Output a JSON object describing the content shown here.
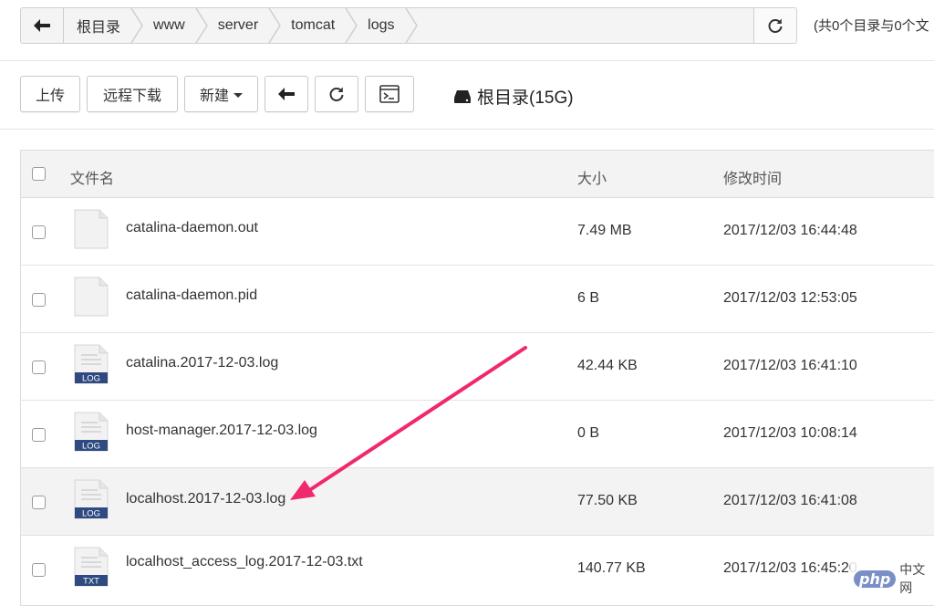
{
  "breadcrumb": {
    "items": [
      "根目录",
      "www",
      "server",
      "tomcat",
      "logs"
    ]
  },
  "summary": "(共0个目录与0个文",
  "toolbar": {
    "upload": "上传",
    "remote_download": "远程下载",
    "new": "新建"
  },
  "disk": {
    "label": "根目录(15G)"
  },
  "table": {
    "headers": {
      "name": "文件名",
      "size": "大小",
      "mtime": "修改时间"
    },
    "rows": [
      {
        "name": "catalina-daemon.out",
        "size": "7.49 MB",
        "mtime": "2017/12/03 16:44:48",
        "icon": "blank-file-icon",
        "badge": ""
      },
      {
        "name": "catalina-daemon.pid",
        "size": "6 B",
        "mtime": "2017/12/03 12:53:05",
        "icon": "blank-file-icon",
        "badge": ""
      },
      {
        "name": "catalina.2017-12-03.log",
        "size": "42.44 KB",
        "mtime": "2017/12/03 16:41:10",
        "icon": "log-file-icon",
        "badge": "LOG"
      },
      {
        "name": "host-manager.2017-12-03.log",
        "size": "0 B",
        "mtime": "2017/12/03 10:08:14",
        "icon": "log-file-icon",
        "badge": "LOG"
      },
      {
        "name": "localhost.2017-12-03.log",
        "size": "77.50 KB",
        "mtime": "2017/12/03 16:41:08",
        "icon": "log-file-icon",
        "badge": "LOG"
      },
      {
        "name": "localhost_access_log.2017-12-03.txt",
        "size": "140.77 KB",
        "mtime": "2017/12/03 16:45:20",
        "icon": "txt-file-icon",
        "badge": "TXT"
      }
    ]
  },
  "watermark": {
    "logo": "php",
    "text": "中文网"
  },
  "colors": {
    "arrow": "#f0286e",
    "badge": "#2f4a80"
  }
}
